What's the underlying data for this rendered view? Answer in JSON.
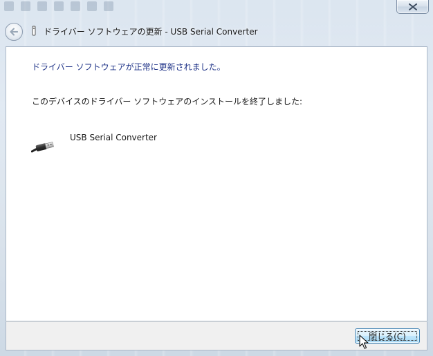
{
  "window": {
    "title": "ドライバー ソフトウェアの更新 - USB Serial Converter"
  },
  "titlebar": {
    "close_icon": "close-x-icon",
    "back_icon": "back-arrow-icon"
  },
  "content": {
    "success_heading": "ドライバー ソフトウェアが正常に更新されました。",
    "install_message": "このデバイスのドライバー ソフトウェアのインストールを終了しました:",
    "device": {
      "icon": "usb-connector-icon",
      "name": "USB Serial Converter"
    }
  },
  "footer": {
    "close_button_label": "閉じる(C)"
  },
  "colors": {
    "heading": "#1e3287",
    "button_border": "#3c7fb1",
    "frame": "#d6e0ea"
  }
}
